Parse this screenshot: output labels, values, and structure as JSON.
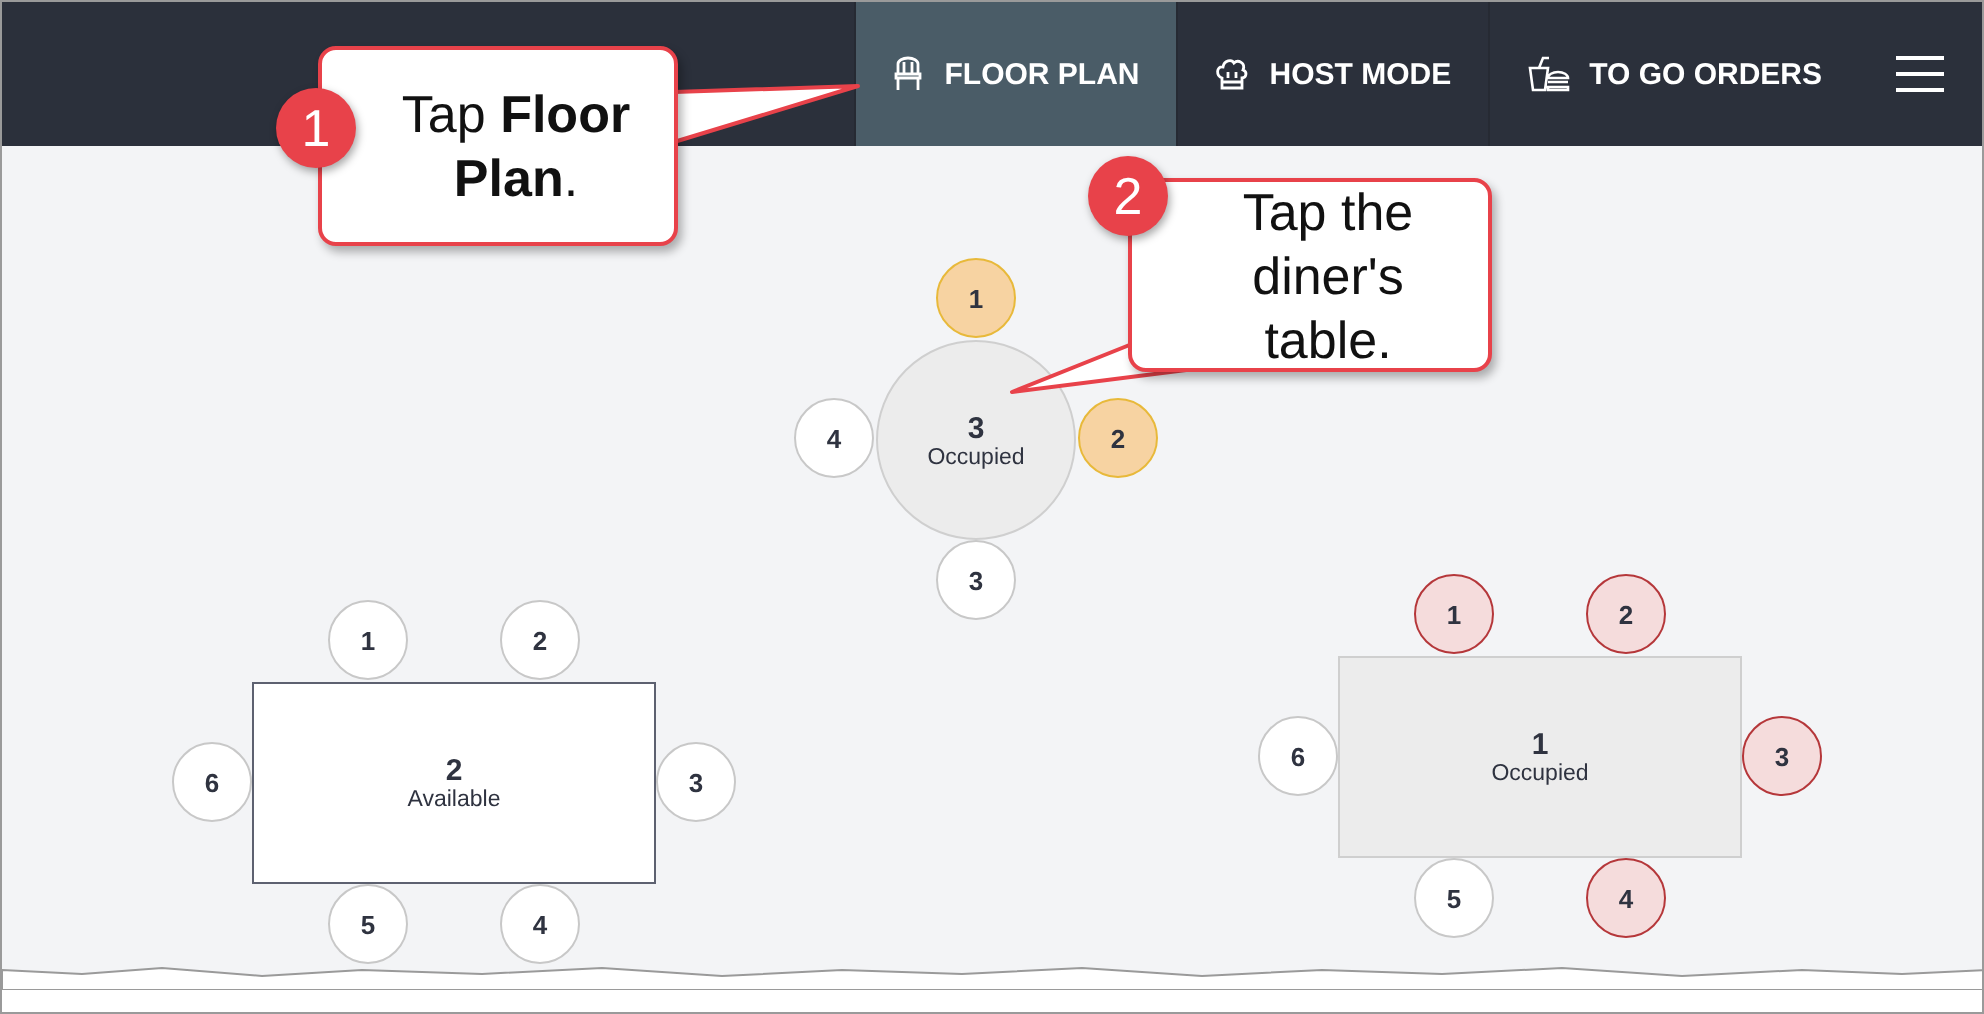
{
  "nav": {
    "tabs": [
      {
        "label": "FLOOR PLAN",
        "selected": true
      },
      {
        "label": "HOST MODE",
        "selected": false
      },
      {
        "label": "TO GO ORDERS",
        "selected": false
      }
    ]
  },
  "tables": [
    {
      "number": "3",
      "status": "Occupied",
      "kind": "round",
      "seats": [
        {
          "label": "1",
          "color": "#f7d3a2"
        },
        {
          "label": "2",
          "color": "#f7d3a2"
        },
        {
          "label": "3",
          "color": "#ffffff"
        },
        {
          "label": "4",
          "color": "#ffffff"
        }
      ]
    },
    {
      "number": "2",
      "status": "Available",
      "kind": "rect",
      "seats": [
        {
          "label": "1",
          "color": "#ffffff"
        },
        {
          "label": "2",
          "color": "#ffffff"
        },
        {
          "label": "3",
          "color": "#ffffff"
        },
        {
          "label": "4",
          "color": "#ffffff"
        },
        {
          "label": "5",
          "color": "#ffffff"
        },
        {
          "label": "6",
          "color": "#ffffff"
        }
      ]
    },
    {
      "number": "1",
      "status": "Occupied",
      "kind": "rect",
      "seats": [
        {
          "label": "1",
          "color": "#f5dcdc"
        },
        {
          "label": "2",
          "color": "#f5dcdc"
        },
        {
          "label": "3",
          "color": "#f5dcdc"
        },
        {
          "label": "4",
          "color": "#f5dcdc"
        },
        {
          "label": "5",
          "color": "#ffffff"
        },
        {
          "label": "6",
          "color": "#ffffff"
        }
      ]
    }
  ],
  "callouts": [
    {
      "step": "1",
      "text": "Tap **Floor Plan**."
    },
    {
      "step": "2",
      "text": "Tap the diner's table."
    }
  ]
}
